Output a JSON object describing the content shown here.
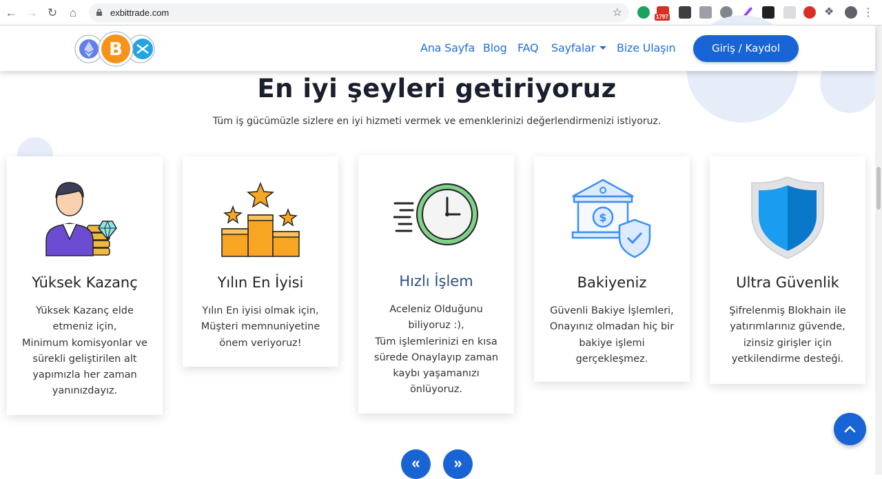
{
  "browser": {
    "url": "exbittrade.com",
    "ext_badge": "1797"
  },
  "header": {
    "nav": [
      {
        "label": "Ana Sayfa"
      },
      {
        "label": "Blog"
      },
      {
        "label": "FAQ"
      },
      {
        "label": "Sayfalar"
      },
      {
        "label": "Bize Ulaşın"
      }
    ],
    "login_label": "Giriş / Kaydol"
  },
  "section": {
    "title": "En iyi şeyleri getiriyoruz",
    "subtitle": "Tüm iş gücümüzle sizlere en iyi hizmeti vermek ve emenklerinizi değerlendirmenizi istiyoruz."
  },
  "cards": [
    {
      "title": "Yüksek Kazanç",
      "icon": "businessman-icon",
      "text": "Yüksek Kazanç elde\netmeniz için,\nMinimum komisyonlar ve\nsürekli geliştirilen alt\nyapımızla her zaman\nyanınızdayız."
    },
    {
      "title": "Yılın En İyisi",
      "icon": "podium-stars-icon",
      "text": "Yılın En iyisi olmak için,\nMüşteri memnuniyetine\nönem veriyoruz!"
    },
    {
      "title": "Hızlı İşlem",
      "icon": "fast-clock-icon",
      "text": "Aceleniz Olduğunu\nbiliyoruz :),\nTüm işlemlerinizi en kısa\nsürede Onaylayıp zaman\nkaybı yaşamanızı\nönlüyoruz."
    },
    {
      "title": "Bakiyeniz",
      "icon": "bank-shield-icon",
      "text": "Güvenli Bakiye İşlemleri,\nOnayınız olmadan hiç bir\nbakiye işlemi\ngerçekleşmez."
    },
    {
      "title": "Ultra Güvenlik",
      "icon": "security-shield-icon",
      "text": "Şifrelenmiş Blokhain ile\nyatırımlarınız güvende,\nizinsiz girişler için\nyetkilendirme desteği."
    }
  ],
  "colors": {
    "brand_blue": "#1864d4",
    "nav_blue": "#1e6fd9",
    "accent_title": "#2b4f86"
  }
}
